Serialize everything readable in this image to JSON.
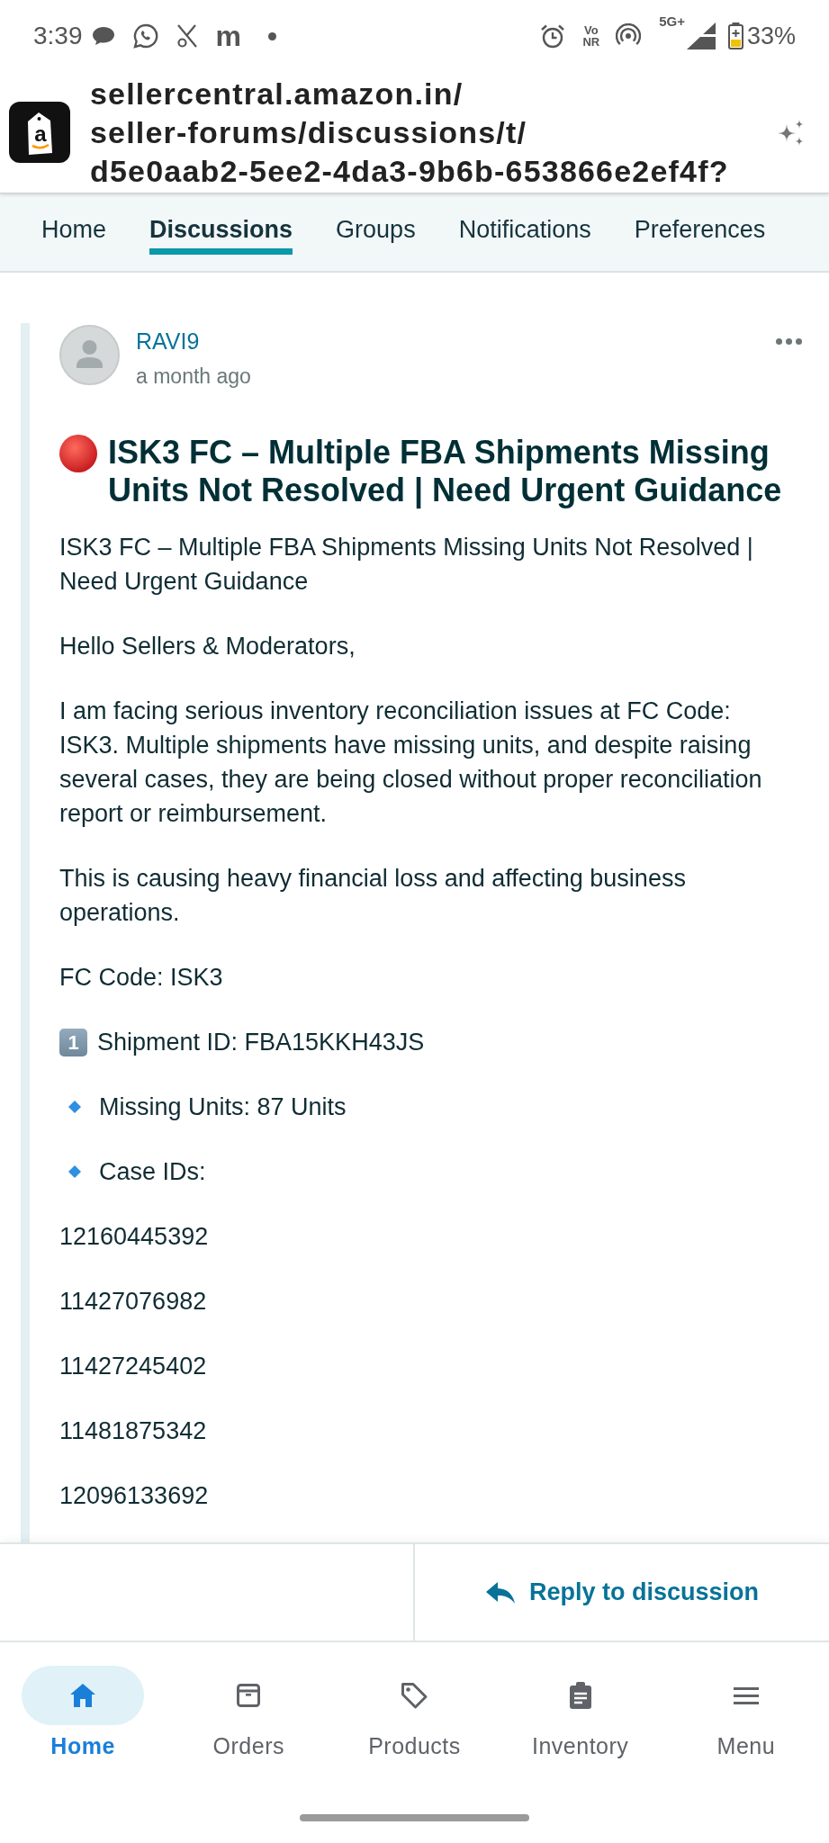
{
  "status_bar": {
    "time": "3:39",
    "notification_letter": "m",
    "voice_lines": [
      "Vo",
      "NR"
    ],
    "network": "5G+",
    "battery": "33%"
  },
  "browser": {
    "logo_letter": "a",
    "url_lines": [
      "sellercentral.amazon.in/",
      "seller-forums/discussions/t/",
      "d5e0aab2-5ee2-4da3-9b6b-653866e2ef4f?"
    ]
  },
  "nav_tabs": [
    {
      "label": "Home",
      "selected": false
    },
    {
      "label": "Discussions",
      "selected": true
    },
    {
      "label": "Groups",
      "selected": false
    },
    {
      "label": "Notifications",
      "selected": false
    },
    {
      "label": "Preferences",
      "selected": false
    }
  ],
  "post": {
    "author": "RAVI9",
    "posted": "a month ago",
    "title": "ISK3 FC – Multiple FBA Shipments Missing Units Not Resolved | Need Urgent Guidance",
    "body": [
      {
        "kind": "paragraph",
        "text": "ISK3 FC – Multiple FBA Shipments Missing Units Not Resolved | Need Urgent Guidance"
      },
      {
        "kind": "paragraph",
        "text": "Hello Sellers & Moderators,"
      },
      {
        "kind": "paragraph",
        "text": "I am facing serious inventory reconciliation issues at FC Code: ISK3. Multiple shipments have missing units, and despite raising several cases, they are being closed without proper reconciliation report or reimbursement."
      },
      {
        "kind": "paragraph",
        "text": "This is causing heavy financial loss and affecting business operations."
      },
      {
        "kind": "paragraph",
        "text": "FC Code: ISK3"
      },
      {
        "kind": "keycap",
        "key": "1",
        "text": "Shipment ID: FBA15KKH43JS"
      },
      {
        "kind": "bullet",
        "text": "Missing Units: 87 Units"
      },
      {
        "kind": "bullet",
        "text": "Case IDs:"
      },
      {
        "kind": "paragraph",
        "text": "12160445392"
      },
      {
        "kind": "paragraph",
        "text": "11427076982"
      },
      {
        "kind": "paragraph",
        "text": "11427245402"
      },
      {
        "kind": "paragraph",
        "text": "11481875342"
      },
      {
        "kind": "paragraph",
        "text": "12096133692"
      }
    ]
  },
  "reply_button": {
    "label": "Reply to discussion"
  },
  "bottom_nav": [
    {
      "label": "Home",
      "selected": true
    },
    {
      "label": "Orders",
      "selected": false
    },
    {
      "label": "Products",
      "selected": false
    },
    {
      "label": "Inventory",
      "selected": false
    },
    {
      "label": "Menu",
      "selected": false
    }
  ]
}
